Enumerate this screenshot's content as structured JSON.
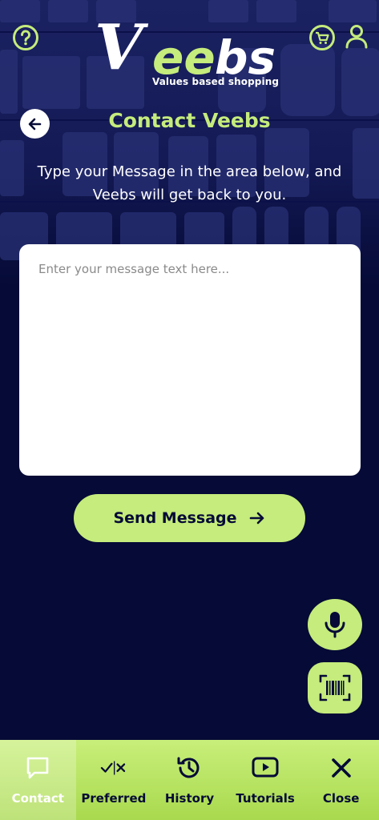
{
  "header": {
    "logo_text": "Veebs",
    "tagline": "Values based shopping",
    "icons": {
      "help": "help-icon",
      "cart": "cart-icon",
      "user": "user-icon"
    }
  },
  "page": {
    "title": "Contact Veebs",
    "instructions": "Type your Message in the area below, and Veebs will get back to you."
  },
  "message": {
    "value": "",
    "placeholder": "Enter your message text here..."
  },
  "send_button": {
    "label": "Send Message",
    "icon": "arrow-right-icon"
  },
  "fabs": {
    "mic": "microphone-icon",
    "barcode": "barcode-scan-icon"
  },
  "bottom_nav": {
    "items": [
      {
        "label": "Contact",
        "icon": "chat-icon",
        "active": true
      },
      {
        "label": "Preferred",
        "icon": "check-x-icon",
        "active": false
      },
      {
        "label": "History",
        "icon": "history-icon",
        "active": false
      },
      {
        "label": "Tutorials",
        "icon": "video-play-icon",
        "active": false
      },
      {
        "label": "Close",
        "icon": "close-icon",
        "active": false
      }
    ]
  },
  "colors": {
    "background": "#050a36",
    "accent": "#c5ec7c",
    "nav_bar": "#b8e35f"
  }
}
